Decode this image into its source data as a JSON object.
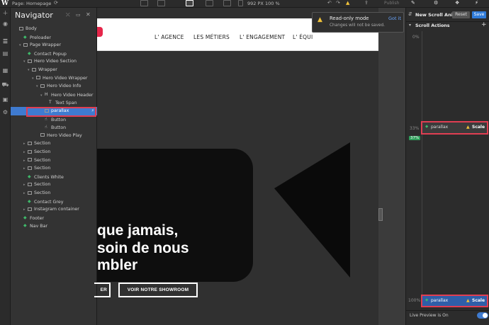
{
  "topbar": {
    "logo": "W",
    "page_label": "Page: Homepage",
    "viewport": "992 PX",
    "zoom": "100 %",
    "publish": "Publish"
  },
  "navigator": {
    "title": "Navigator",
    "items": [
      {
        "label": "Body",
        "type": "box",
        "depth": 0,
        "caret": ""
      },
      {
        "label": "Preloader",
        "type": "comp",
        "depth": 1,
        "caret": ""
      },
      {
        "label": "Page Wrapper",
        "type": "box",
        "depth": 1,
        "caret": "▾"
      },
      {
        "label": "Contact Popup",
        "type": "comp",
        "depth": 2,
        "caret": ""
      },
      {
        "label": "Hero Video Section",
        "type": "section",
        "depth": 2,
        "caret": "▾"
      },
      {
        "label": "Wrapper",
        "type": "box",
        "depth": 3,
        "caret": "▾"
      },
      {
        "label": "Hero Video Wrapper",
        "type": "box",
        "depth": 4,
        "caret": "▾"
      },
      {
        "label": "Hero Video Info",
        "type": "box",
        "depth": 5,
        "caret": "▾"
      },
      {
        "label": "Hero Video Header",
        "type": "heading",
        "depth": 6,
        "caret": "▾"
      },
      {
        "label": "Text Span",
        "type": "text",
        "depth": 7,
        "caret": ""
      },
      {
        "label": "parallax",
        "type": "box",
        "depth": 6,
        "caret": "",
        "selected": true
      },
      {
        "label": "Button",
        "type": "link",
        "depth": 6,
        "caret": ""
      },
      {
        "label": "Button",
        "type": "link",
        "depth": 6,
        "caret": ""
      },
      {
        "label": "Hero Video Play",
        "type": "box",
        "depth": 5,
        "caret": ""
      },
      {
        "label": "Section",
        "type": "section",
        "depth": 2,
        "caret": "▸"
      },
      {
        "label": "Section",
        "type": "section",
        "depth": 2,
        "caret": "▸"
      },
      {
        "label": "Section",
        "type": "section",
        "depth": 2,
        "caret": "▸"
      },
      {
        "label": "Section",
        "type": "section",
        "depth": 2,
        "caret": "▸"
      },
      {
        "label": "Clients White",
        "type": "comp",
        "depth": 2,
        "caret": ""
      },
      {
        "label": "Section",
        "type": "section",
        "depth": 2,
        "caret": "▸"
      },
      {
        "label": "Section",
        "type": "section",
        "depth": 2,
        "caret": "▸"
      },
      {
        "label": "Contact Grey",
        "type": "comp",
        "depth": 2,
        "caret": ""
      },
      {
        "label": "Instagram container",
        "type": "box",
        "depth": 2,
        "caret": "▸"
      },
      {
        "label": "Footer",
        "type": "comp",
        "depth": 1,
        "caret": ""
      },
      {
        "label": "Nav Bar",
        "type": "comp",
        "depth": 1,
        "caret": ""
      }
    ]
  },
  "site": {
    "menu": [
      "L' AGENCE",
      "LES MÉTIERS",
      "L' ENGAGEMENT",
      "L' ÉQUI"
    ],
    "hero_lines": [
      "que jamais,",
      "soin de nous",
      "mbler"
    ],
    "btn_left": "ER",
    "btn_right": "VOIR NOTRE SHOWROOM"
  },
  "toast": {
    "title": "Read-only mode",
    "body": "Changes will not be saved.",
    "action": "Got it"
  },
  "panel": {
    "title": "New Scroll Ani...",
    "reset": "Reset",
    "save": "Save",
    "section": "Scroll Actions",
    "pct_top": "0%",
    "pct_mid": "33%",
    "badge": "37%",
    "pct_bottom": "100%",
    "action_label": "parallax",
    "action_type": "Scale",
    "live_preview": "Live Preview is On"
  },
  "colors": {
    "accent": "#3f7bd0",
    "highlight": "#e03e52",
    "green": "#2f9e5a",
    "warning": "#f0c23a"
  }
}
